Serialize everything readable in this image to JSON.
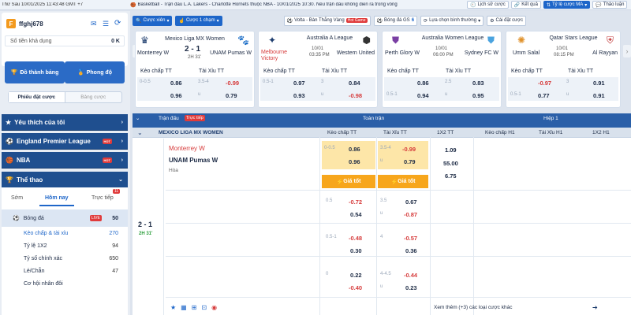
{
  "top": {
    "datetime": "Thứ Sáu 10/01/2025 11:43:48 GMT +7",
    "ticker": "Basketball - Trận đấu L.A. Lakers - Charlotte Hornets thuộc NBA - 10/01/2025 10:30. Nếu trận đấu không diễn ra trong vòng",
    "history": "Lịch sử cược",
    "results": "Kết quả",
    "odds_type": "Tỷ lệ cược MA",
    "help": "Thảo luận"
  },
  "user": {
    "name": "ffghj678",
    "balance_label": "Số tiền khả dụng",
    "balance": "0 K",
    "btn_tongtien": "Đồ thành bảng",
    "btn_phongdo": "Phong độ",
    "tab_betslip": "Phiếu đặt cược",
    "tab_board": "Bảng cược"
  },
  "filters": {
    "btn_combo": "Cược xiên",
    "btn_quick": "Cược 1 chạm",
    "volta_label": "Volta - Bàn Thắng Vàng",
    "hot": "Hot Game",
    "bongda_gs": "Bóng đá GS",
    "gs_count": "6",
    "select_normal": "Lựa chọn bình thường",
    "settings": "Cài đặt cược"
  },
  "categories": [
    {
      "label": "Yêu thích của tôi"
    },
    {
      "label": "England Premier League",
      "hot": "HOT"
    },
    {
      "label": "NBA",
      "hot": "HOT"
    },
    {
      "label": "Thể thao"
    }
  ],
  "sport_tabs": {
    "early": "Sớm",
    "today": "Hôm nay",
    "live": "Trực tiếp",
    "live_badge": "11"
  },
  "sports": {
    "football": "Bóng đá",
    "football_live": "LIVE",
    "football_count": "50",
    "items": [
      {
        "label": "Kèo chấp & tài xỉu",
        "count": "270"
      },
      {
        "label": "Tỷ lệ 1X2",
        "count": "94"
      },
      {
        "label": "Tỷ số chính xác",
        "count": "650"
      },
      {
        "label": "Lẻ/Chẵn",
        "count": "47"
      },
      {
        "label": "Cơ hội nhân đôi",
        "count": ""
      }
    ]
  },
  "cards": [
    {
      "league": "Mexico Liga MX Women",
      "home": "Monterrey W",
      "away": "UNAM Pumas W",
      "score": "2 - 1",
      "time": "2H 31'",
      "hcap_label": "Kèo chấp TT",
      "ou_label": "Tài Xỉu TT",
      "r1": [
        "0-0.5",
        "0.86",
        "3.5-4",
        "-0.99"
      ],
      "r2": [
        "",
        "0.96",
        "u",
        "0.79"
      ]
    },
    {
      "league": "Australia A League",
      "home": "Melbourne Victory",
      "away": "Western United",
      "date": "10/01",
      "time": "03:35 PM",
      "hcap_label": "Kèo chấp TT",
      "ou_label": "Tài Xỉu TT",
      "r1": [
        "0.5-1",
        "0.97",
        "3",
        "0.84"
      ],
      "r2": [
        "",
        "0.93",
        "u",
        "-0.98"
      ]
    },
    {
      "league": "Australia Women League",
      "home": "Perth Glory W",
      "away": "Sydney FC W",
      "date": "10/01",
      "time": "06:00 PM",
      "hcap_label": "Kèo chấp TT",
      "ou_label": "Tài Xỉu TT",
      "r1": [
        "",
        "0.86",
        "2.5",
        "0.83"
      ],
      "r2": [
        "0.5-1",
        "0.94",
        "u",
        "0.95"
      ]
    },
    {
      "league": "Qatar Stars League",
      "home": "Umm Salal",
      "away": "Al Rayyan",
      "date": "10/01",
      "time": "08:15 PM",
      "hcap_label": "Kèo chấp TT",
      "ou_label": "Tài Xỉu TT",
      "r1": [
        "",
        "-0.97",
        "3",
        "0.91"
      ],
      "r2": [
        "0.5-1",
        "0.77",
        "u",
        "0.91"
      ]
    }
  ],
  "table": {
    "header_match": "Trận đấu",
    "live_tag": "Trực tiếp",
    "header_full": "Toàn trận",
    "header_half": "Hiệp 1",
    "col_hcap": "Kèo chấp TT",
    "col_ou": "Tài Xỉu TT",
    "col_1x2": "1X2 TT",
    "col_hcap_h1": "Kèo chấp H1",
    "col_ou_h1": "Tài Xỉu H1",
    "col_1x2_h1": "1X2 H1",
    "league": "MEXICO LIGA MX WOMEN",
    "home": "Monterrey W",
    "away": "UNAM Pumas W",
    "draw": "Hòa",
    "score": "2 - 1",
    "time": "2H 31'",
    "best_price": "Giá tốt",
    "rows": [
      {
        "hl": "0-0.5",
        "hh": "0.86",
        "ol": "3.5-4",
        "oh": "-0.99",
        "ha": "0.96",
        "ou": "u",
        "oa": "0.79"
      },
      {
        "hl": "0.5",
        "hh": "-0.72",
        "ol": "3.5",
        "oh": "0.67",
        "ha": "0.54",
        "ou": "u",
        "oa": "-0.87"
      },
      {
        "hl": "0.5-1",
        "hh": "-0.48",
        "ol": "4",
        "oh": "-0.57",
        "ha": "0.30",
        "ou": "u",
        "oa": "0.36"
      },
      {
        "hl": "0",
        "hh": "0.22",
        "ol": "4-4.5",
        "oh": "-0.44",
        "ha": "-0.40",
        "ou": "u",
        "oa": "0.23"
      }
    ],
    "x12": [
      "1.09",
      "55.00",
      "6.75"
    ],
    "more": "Xem thêm (+3) các loại cược khác"
  }
}
